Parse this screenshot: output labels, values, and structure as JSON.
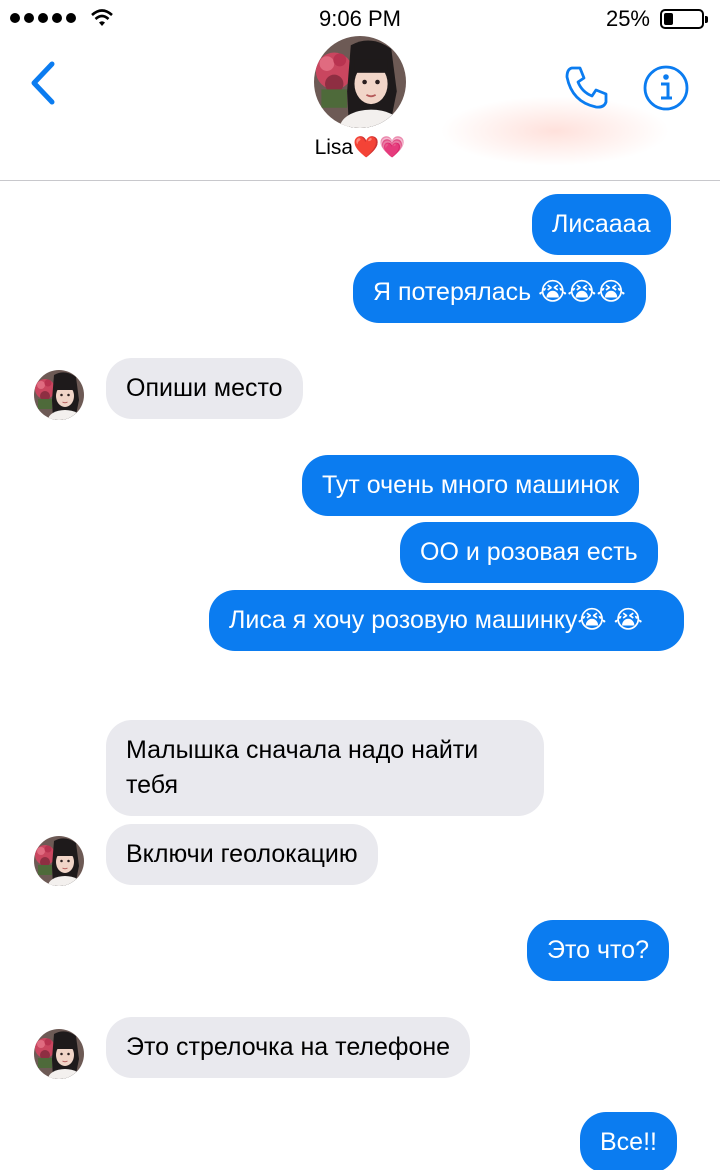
{
  "status_bar": {
    "time": "9:06 PM",
    "battery_percent": "25%"
  },
  "header": {
    "contact_name": "Lisa❤️💗",
    "icons": {
      "back": "chevron-left-icon",
      "phone": "phone-icon",
      "info": "info-icon"
    }
  },
  "colors": {
    "accent": "#0b7cf0",
    "incoming_bubble": "#e9e9ee"
  },
  "messages": [
    {
      "direction": "outgoing",
      "text": "Лисаааа"
    },
    {
      "direction": "outgoing",
      "text": "Я потерялась 😭😭😭"
    },
    {
      "direction": "incoming",
      "text": "Опиши место"
    },
    {
      "direction": "outgoing",
      "text": "Тут очень много машинок"
    },
    {
      "direction": "outgoing",
      "text": "ОО и розовая есть"
    },
    {
      "direction": "outgoing",
      "text": "Лиса я хочу розовую машинку😭 😭"
    },
    {
      "direction": "incoming",
      "text": "Малышка сначала надо найти тебя"
    },
    {
      "direction": "incoming",
      "text": "Включи геолокацию"
    },
    {
      "direction": "outgoing",
      "text": "Это что?"
    },
    {
      "direction": "incoming",
      "text": "Это стрелочка на телефоне"
    },
    {
      "direction": "outgoing",
      "text": "Все!!"
    }
  ]
}
